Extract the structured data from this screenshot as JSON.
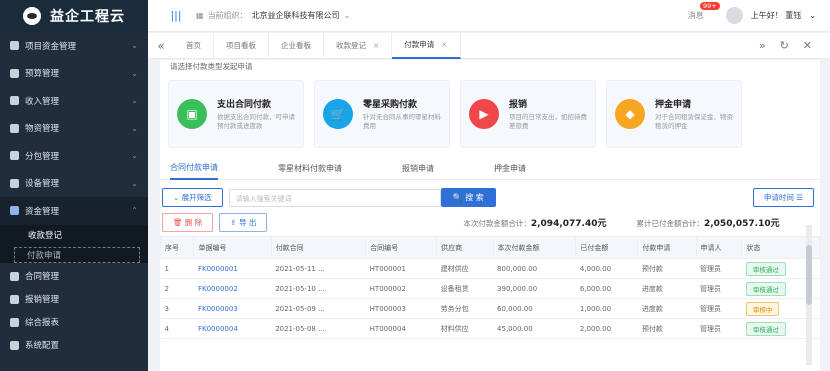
{
  "app": {
    "name": "益企工程云"
  },
  "sidebar": {
    "items": [
      {
        "label": "项目资金管理"
      },
      {
        "label": "预算管理"
      },
      {
        "label": "收入管理"
      },
      {
        "label": "物资管理"
      },
      {
        "label": "分包管理"
      },
      {
        "label": "设备管理"
      },
      {
        "label": "资金管理"
      }
    ],
    "sub_items": [
      {
        "label": "收款登记"
      },
      {
        "label": "付款申请"
      }
    ],
    "bottom_items": [
      {
        "label": "合同管理"
      },
      {
        "label": "报销管理"
      },
      {
        "label": "综合报表"
      },
      {
        "label": "系统配置"
      }
    ]
  },
  "header": {
    "org_label": "当前组织：",
    "org_name": "北京益企联科技有限公司",
    "msg_label": "消息",
    "msg_badge": "99+",
    "greeting": "上午好！ 董钰"
  },
  "tabs": [
    {
      "label": "首页"
    },
    {
      "label": "项目看板"
    },
    {
      "label": "企业看板"
    },
    {
      "label": "收款登记"
    },
    {
      "label": "付款申请"
    }
  ],
  "hint": "请选择付款类型发起申请",
  "cards": [
    {
      "title": "支出合同付款",
      "desc": "依据支出合同付款，可申请预付款或进度款",
      "color": "#3bbf5a",
      "icon": "document-icon"
    },
    {
      "title": "零星采购付款",
      "desc": "针对无合同从事的零星材料费用",
      "color": "#1aa4e8",
      "icon": "cart-icon"
    },
    {
      "title": "报销",
      "desc": "项目的日常支出，如招待费差旅费",
      "color": "#f0484a",
      "icon": "receipt-icon"
    },
    {
      "title": "押金申请",
      "desc": "对于合同租赁保证金、物资租赁的押金",
      "color": "#f5a623",
      "icon": "deposit-icon"
    }
  ],
  "sub_tabs": [
    {
      "label": "合同付款申请"
    },
    {
      "label": "零星材料付款申请"
    },
    {
      "label": "报销申请"
    },
    {
      "label": "押金申请"
    }
  ],
  "filter": {
    "expand_label": "展开筛选",
    "search_placeholder": "请输入搜索关键词",
    "search_label": "搜 索",
    "right_label": "申请时间 ☰"
  },
  "actions": {
    "delete_label": "删 除",
    "export_label": "导 出",
    "sum1_label": "本次付款金额合计：",
    "sum1_value": "2,094,077.40元",
    "sum2_label": "累计已付金额合计：",
    "sum2_value": "2,050,057.10元"
  },
  "table": {
    "headers": [
      "序号",
      "单据编号",
      "付款合同",
      "合同编号",
      "供应商",
      "本次付款金额",
      "已付金额",
      "付款申请",
      "申请人",
      "状态"
    ],
    "rows": [
      [
        "1",
        "FK0000001",
        "2021-05-11 ...",
        "HT000001",
        "建材供应",
        "800,000.00",
        "4,000.00",
        "预付款",
        "管理员",
        "审核通过"
      ],
      [
        "2",
        "FK0000002",
        "2021-05-10 ...",
        "HT000002",
        "设备租赁",
        "390,000.00",
        "6,000.00",
        "进度款",
        "管理员",
        "审核通过"
      ],
      [
        "3",
        "FK0000003",
        "2021-05-09 ...",
        "HT000003",
        "劳务分包",
        "60,000.00",
        "1,000.00",
        "进度款",
        "管理员",
        "审核中"
      ],
      [
        "4",
        "FK0000004",
        "2021-05-08 ...",
        "HT000004",
        "材料供应",
        "45,000.00",
        "2,000.00",
        "预付款",
        "管理员",
        "审核通过"
      ]
    ],
    "status_colors": {
      "审核通过": "green",
      "审核中": "orange"
    }
  }
}
